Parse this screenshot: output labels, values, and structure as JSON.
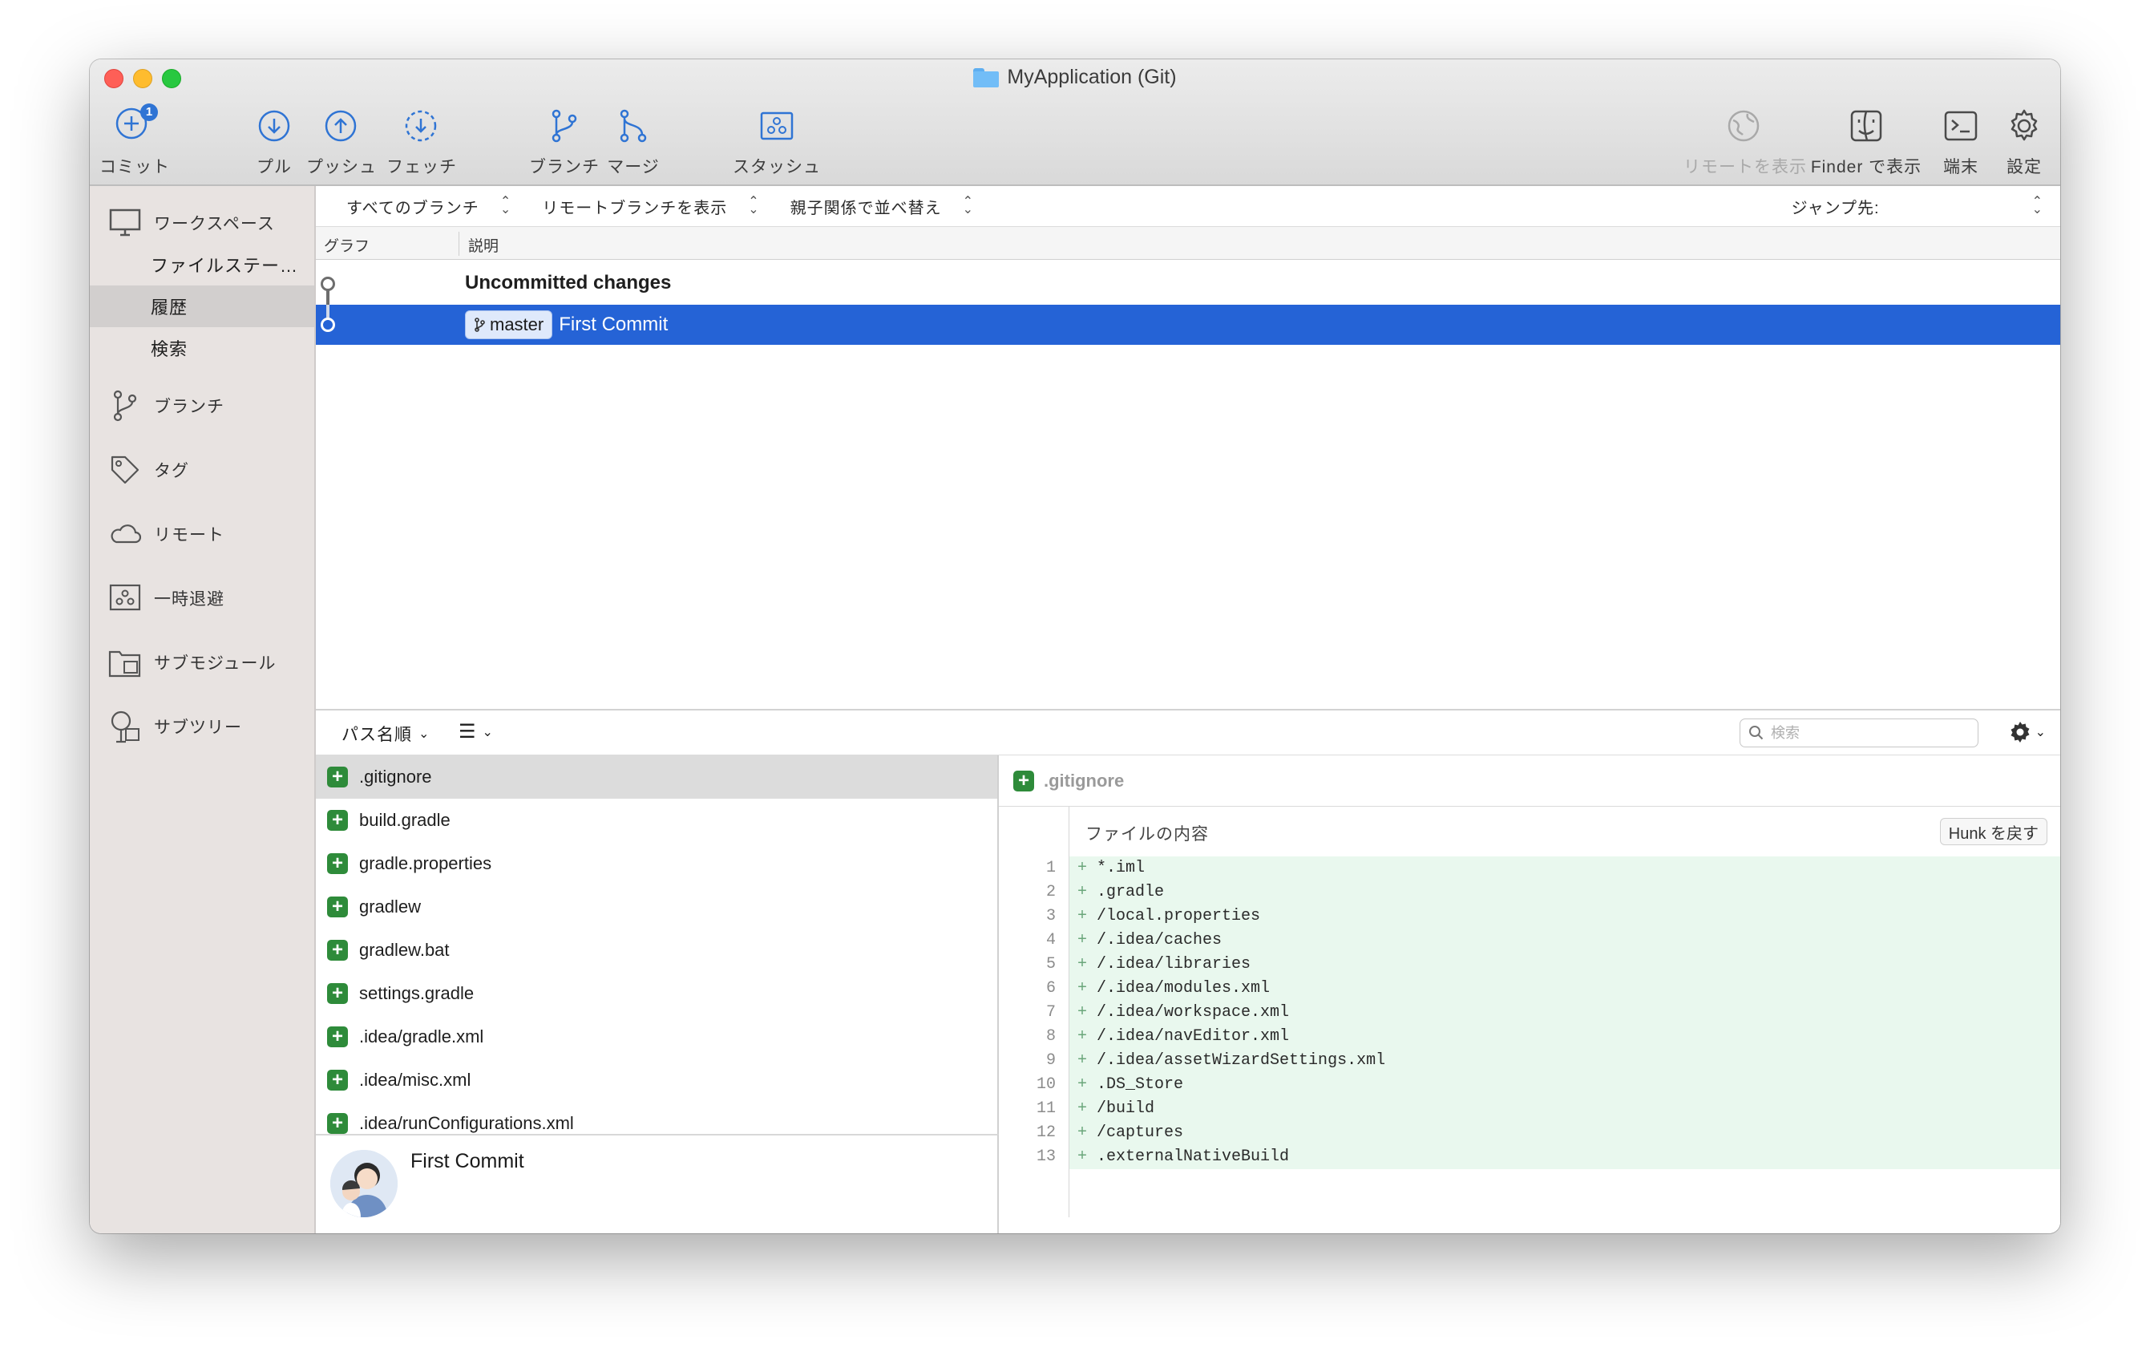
{
  "window": {
    "title": "MyApplication (Git)"
  },
  "toolbar": {
    "commit": {
      "label": "コミット",
      "badge": "1"
    },
    "pull": {
      "label": "プル"
    },
    "push": {
      "label": "プッシュ"
    },
    "fetch": {
      "label": "フェッチ"
    },
    "branch": {
      "label": "ブランチ"
    },
    "merge": {
      "label": "マージ"
    },
    "stash": {
      "label": "スタッシュ"
    },
    "remote": {
      "label": "リモートを表示"
    },
    "finder": {
      "label": "Finder で表示"
    },
    "terminal": {
      "label": "端末"
    },
    "settings": {
      "label": "設定"
    }
  },
  "sidebar": {
    "workspace": "ワークスペース",
    "workspace_items": [
      "ファイルステー…",
      "履歴",
      "検索"
    ],
    "selected_item": "履歴",
    "sections": [
      "ブランチ",
      "タグ",
      "リモート",
      "一時退避",
      "サブモジュール",
      "サブツリー"
    ]
  },
  "history": {
    "filters": [
      "すべてのブランチ",
      "リモートブランチを表示",
      "親子関係で並べ替え"
    ],
    "jump_label": "ジャンプ先:",
    "columns": {
      "graph": "グラフ",
      "description": "説明"
    },
    "rows": [
      {
        "description": "Uncommitted changes"
      },
      {
        "branch": "master",
        "description": "First Commit"
      }
    ]
  },
  "files_toolbar": {
    "sort_label": "パス名順",
    "search_placeholder": "検索"
  },
  "files": [
    ".gitignore",
    "build.gradle",
    "gradle.properties",
    "gradlew",
    "gradlew.bat",
    "settings.gradle",
    ".idea/gradle.xml",
    ".idea/misc.xml",
    ".idea/runConfigurations.xml"
  ],
  "commit_details": {
    "message": "First Commit"
  },
  "diff": {
    "file": ".gitignore",
    "hunk_label": "ファイルの内容",
    "revert_button": "Hunk を戻す",
    "lines": [
      {
        "n": "1",
        "text": "*.iml"
      },
      {
        "n": "2",
        "text": ".gradle"
      },
      {
        "n": "3",
        "text": "/local.properties"
      },
      {
        "n": "4",
        "text": "/.idea/caches"
      },
      {
        "n": "5",
        "text": "/.idea/libraries"
      },
      {
        "n": "6",
        "text": "/.idea/modules.xml"
      },
      {
        "n": "7",
        "text": "/.idea/workspace.xml"
      },
      {
        "n": "8",
        "text": "/.idea/navEditor.xml"
      },
      {
        "n": "9",
        "text": "/.idea/assetWizardSettings.xml"
      },
      {
        "n": "10",
        "text": ".DS_Store"
      },
      {
        "n": "11",
        "text": "/build"
      },
      {
        "n": "12",
        "text": "/captures"
      },
      {
        "n": "13",
        "text": ".externalNativeBuild"
      }
    ]
  },
  "colors": {
    "selection": "#2563d6",
    "added": "#e9f8ee",
    "add_icon": "#2e8b3a"
  }
}
